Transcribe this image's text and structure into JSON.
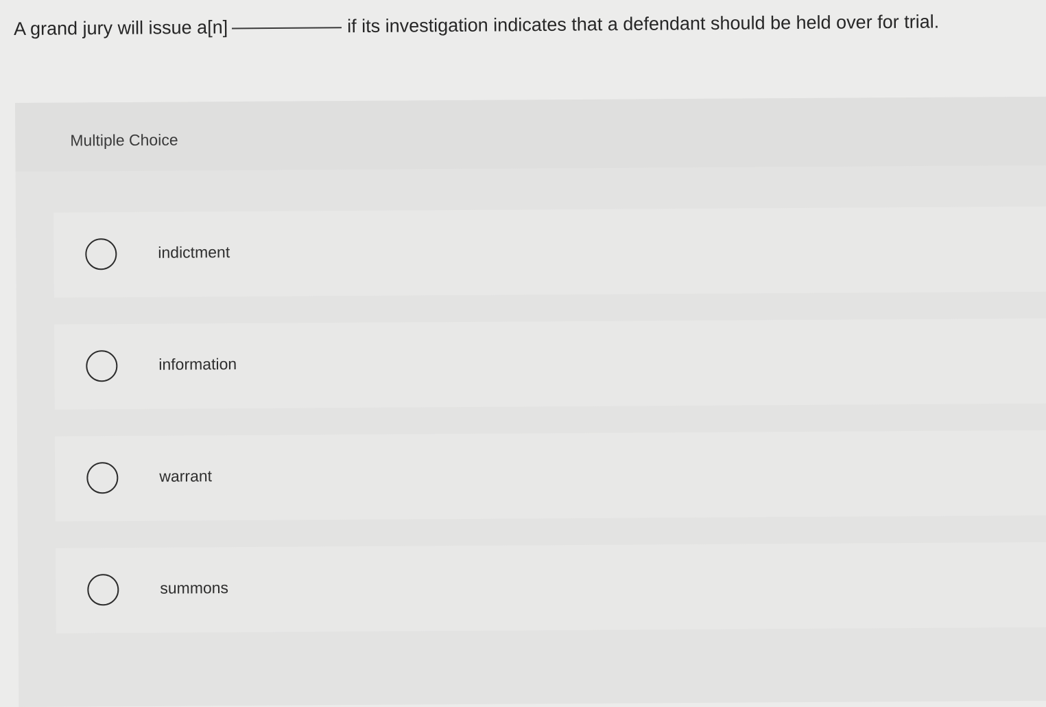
{
  "question": {
    "before_blank": "A grand jury will issue a[n]",
    "after_blank": "if its investigation indicates that a defendant should be held over for trial."
  },
  "mc": {
    "label": "Multiple Choice",
    "options": [
      {
        "label": "indictment"
      },
      {
        "label": "information"
      },
      {
        "label": "warrant"
      },
      {
        "label": "summons"
      }
    ]
  },
  "colors": {
    "background": "#ececeb",
    "panel": "#e3e3e2",
    "option_row": "#e8e8e7",
    "text": "#2b2b2b"
  }
}
